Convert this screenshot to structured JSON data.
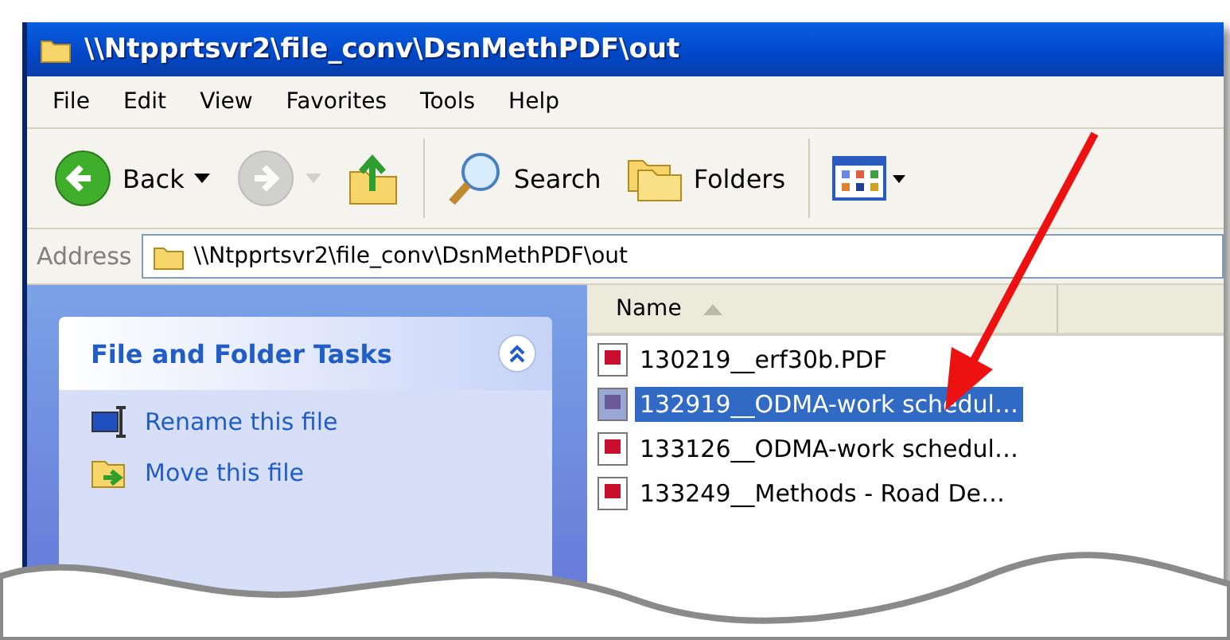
{
  "window": {
    "title": "\\\\Ntpprtsvr2\\file_conv\\DsnMethPDF\\out"
  },
  "menu": [
    "File",
    "Edit",
    "View",
    "Favorites",
    "Tools",
    "Help"
  ],
  "toolbar": [
    {
      "kind": "back",
      "label": "Back",
      "disabled": false
    },
    {
      "kind": "forward",
      "disabled": true
    },
    {
      "kind": "up",
      "disabled": false
    },
    {
      "kind": "search",
      "label": "Search",
      "disabled": false
    },
    {
      "kind": "folders",
      "label": "Folders",
      "disabled": false
    },
    {
      "kind": "views",
      "disabled": false
    }
  ],
  "address": {
    "label": "Address",
    "value": "\\\\Ntpprtsvr2\\file_conv\\DsnMethPDF\\out"
  },
  "tasks": {
    "title": "File and Folder Tasks",
    "expanded": true,
    "items": [
      {
        "kind": "rename",
        "label": "Rename this file"
      },
      {
        "kind": "move",
        "label": "Move this file"
      }
    ]
  },
  "file_list": {
    "columns": [
      {
        "label": "Name",
        "sorted": true
      }
    ],
    "rows": [
      {
        "name": "130219__erf30b.PDF",
        "selected": false
      },
      {
        "name": "132919__ODMA-work schedul…",
        "selected": true
      },
      {
        "name": "133126__ODMA-work schedul…",
        "selected": false
      },
      {
        "name": "133249__Methods - Road De…",
        "selected": false
      }
    ]
  }
}
